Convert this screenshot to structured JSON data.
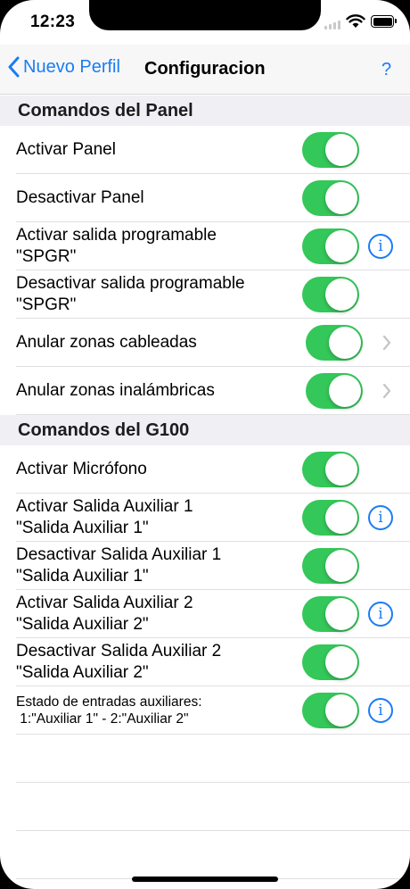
{
  "status": {
    "time": "12:23"
  },
  "nav": {
    "back_label": "Nuevo Perfil",
    "title": "Configuracion",
    "help_label": "?"
  },
  "sections": [
    {
      "header": "Comandos del Panel",
      "rows": [
        {
          "line1": "Activar Panel",
          "line2": "",
          "on": true,
          "accessory": "none"
        },
        {
          "line1": "Desactivar Panel",
          "line2": "",
          "on": true,
          "accessory": "none"
        },
        {
          "line1": "Activar salida programable",
          "line2": "\"SPGR\"",
          "on": true,
          "accessory": "info"
        },
        {
          "line1": "Desactivar salida programable",
          "line2": "\"SPGR\"",
          "on": true,
          "accessory": "none"
        },
        {
          "line1": "Anular zonas cableadas",
          "line2": "",
          "on": true,
          "accessory": "chevron"
        },
        {
          "line1": "Anular zonas inalámbricas",
          "line2": "",
          "on": true,
          "accessory": "chevron"
        }
      ]
    },
    {
      "header": "Comandos del G100",
      "rows": [
        {
          "line1": "Activar Micrófono",
          "line2": "",
          "on": true,
          "accessory": "none"
        },
        {
          "line1": "Activar Salida Auxiliar 1",
          "line2": "\"Salida Auxiliar 1\"",
          "on": true,
          "accessory": "info"
        },
        {
          "line1": "Desactivar Salida Auxiliar 1",
          "line2": "\"Salida Auxiliar 1\"",
          "on": true,
          "accessory": "none"
        },
        {
          "line1": "Activar Salida Auxiliar 2",
          "line2": "\"Salida Auxiliar 2\"",
          "on": true,
          "accessory": "info"
        },
        {
          "line1": "Desactivar Salida Auxiliar 2",
          "line2": "\"Salida Auxiliar 2\"",
          "on": true,
          "accessory": "none"
        },
        {
          "line1": "Estado de entradas auxiliares:",
          "line2": " 1:\"Auxiliar 1\" - 2:\"Auxiliar 2\"",
          "on": true,
          "accessory": "info",
          "small": true
        }
      ]
    }
  ],
  "colors": {
    "accent": "#1a7cf5",
    "toggle_on": "#34c759",
    "section_bg": "#efeff4"
  },
  "icons": {
    "back": "chevron-left-icon",
    "info": "info-circle-icon",
    "disclosure": "chevron-right-icon"
  }
}
